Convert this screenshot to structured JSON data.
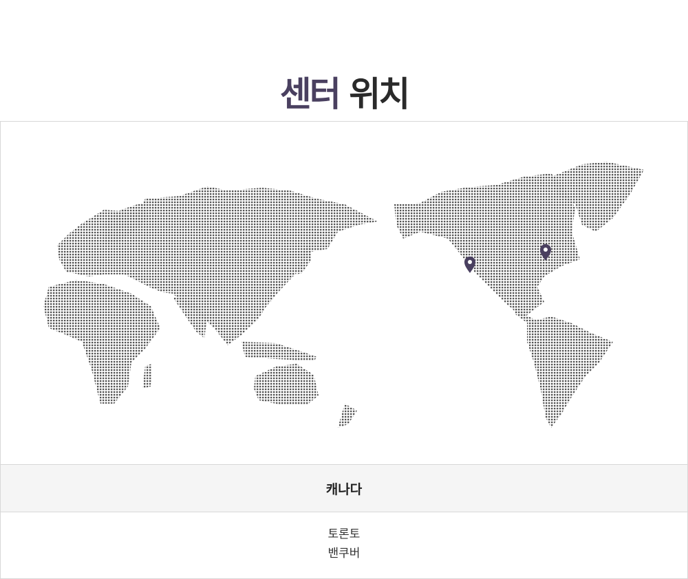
{
  "page": {
    "title_accent": "센터",
    "title_main": "위치"
  },
  "map": {
    "dot_color": "#555555",
    "pin_color": "#4a4060",
    "pins": [
      {
        "name": "toronto-pin",
        "label": "토론토"
      },
      {
        "name": "vancouver-pin",
        "label": "밴쿠버"
      }
    ]
  },
  "country": {
    "name": "캐나다"
  },
  "cities": [
    "토론토",
    "밴쿠버"
  ]
}
